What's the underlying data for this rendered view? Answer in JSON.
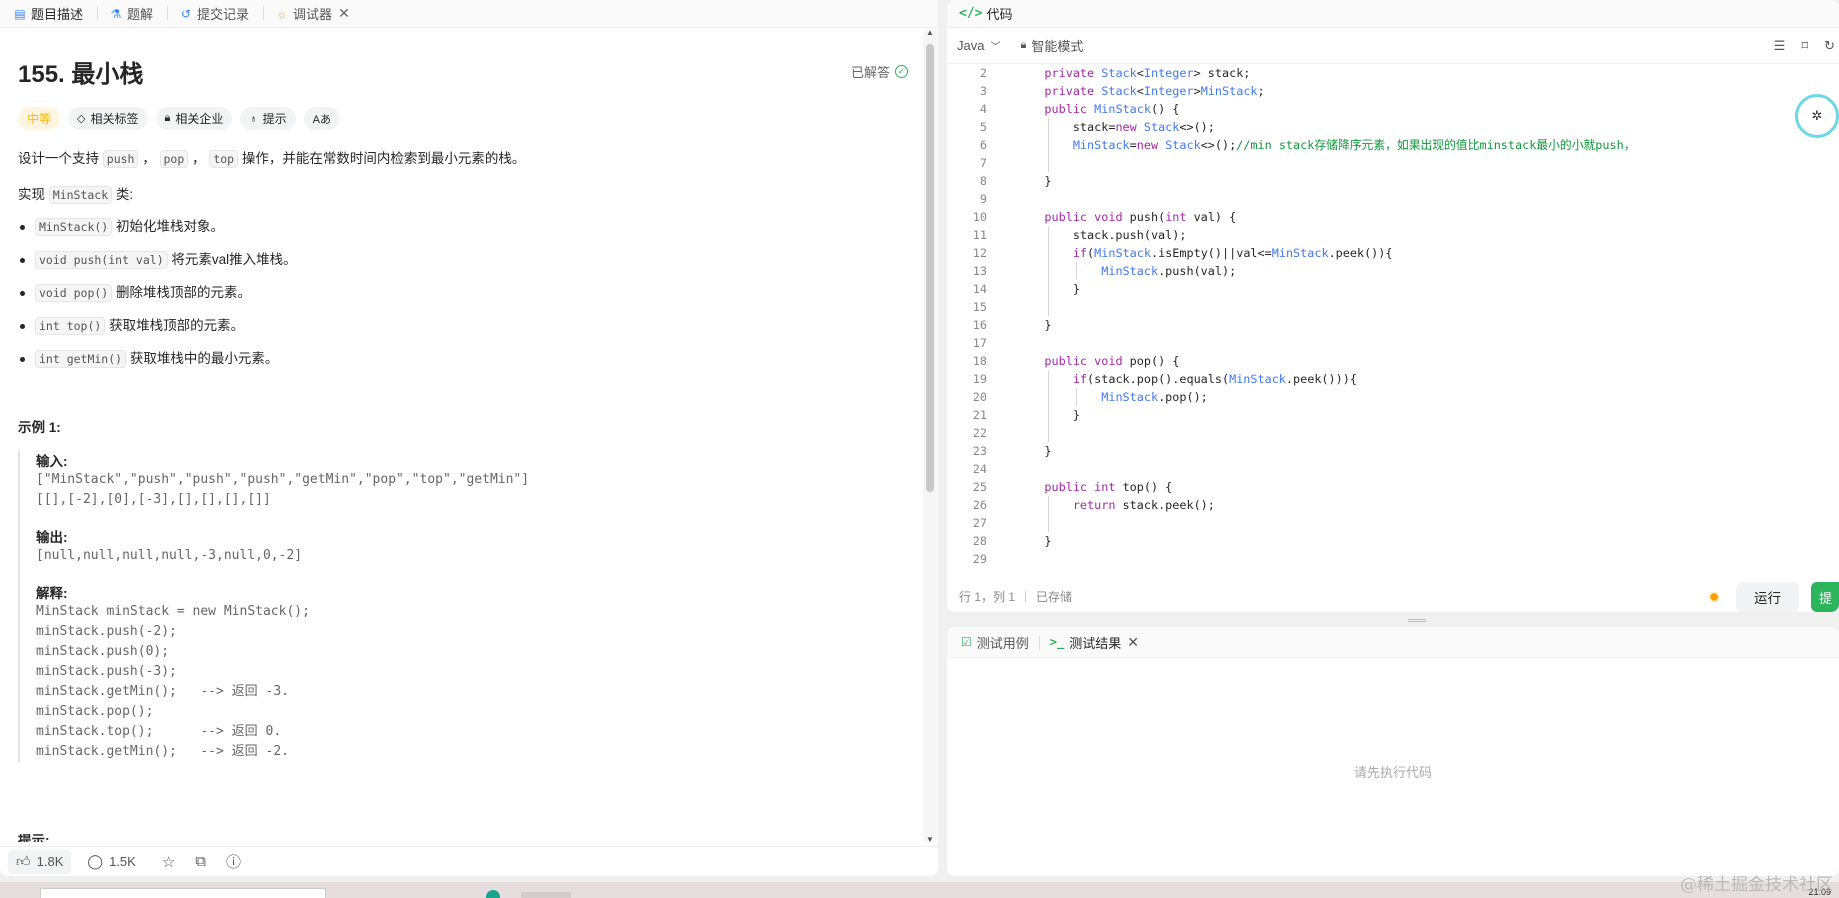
{
  "left_tabs": [
    {
      "label": "题目描述",
      "icon": "document-icon"
    },
    {
      "label": "题解",
      "icon": "flask-icon"
    },
    {
      "label": "提交记录",
      "icon": "history-icon"
    },
    {
      "label": "调试器",
      "icon": "debugger-icon",
      "close": "✕"
    }
  ],
  "problem": {
    "title": "155. 最小栈",
    "solved_label": "已解答",
    "tags": {
      "difficulty": "中等",
      "related_tags": "相关标签",
      "related_companies": "相关企业",
      "hint": "提示",
      "translate": "Aあ"
    },
    "desc_prefix": "设计一个支持",
    "desc_sep1": "，",
    "desc_sep2": "，",
    "desc_suffix": "操作，并能在常数时间内检索到最小元素的栈。",
    "desc_push": "push",
    "desc_pop": "pop",
    "desc_top": "top",
    "impl_prefix": "实现",
    "impl_class": "MinStack",
    "impl_suffix": "类:",
    "methods": [
      {
        "code": "MinStack()",
        "text": "初始化堆栈对象。"
      },
      {
        "code": "void push(int val)",
        "text": "将元素val推入堆栈。"
      },
      {
        "code": "void pop()",
        "text": "删除堆栈顶部的元素。"
      },
      {
        "code": "int top()",
        "text": "获取堆栈顶部的元素。"
      },
      {
        "code": "int getMin()",
        "text": "获取堆栈中的最小元素。"
      }
    ],
    "example_title": "示例 1:",
    "input_label": "输入:",
    "input_line1": "[\"MinStack\",\"push\",\"push\",\"push\",\"getMin\",\"pop\",\"top\",\"getMin\"]",
    "input_line2": "[[],[-2],[0],[-3],[],[],[],[]]",
    "output_label": "输出:",
    "output_line": "[null,null,null,null,-3,null,0,-2]",
    "explain_label": "解释:",
    "explain_lines": [
      "MinStack minStack = new MinStack();",
      "minStack.push(-2);",
      "minStack.push(0);",
      "minStack.push(-3);",
      "minStack.getMin();   --> 返回 -3.",
      "minStack.pop();",
      "minStack.top();      --> 返回 0.",
      "minStack.getMin();   --> 返回 -2."
    ],
    "hints_heading": "提示:"
  },
  "bottom_bar": {
    "likes": "1.8K",
    "comments": "1.5K"
  },
  "code_panel": {
    "title": "代码",
    "language": "Java",
    "mode": "智能模式",
    "status_position": "行 1，列 1",
    "status_saved": "已存储",
    "run_label": "运行",
    "submit_label": "提"
  },
  "code_lines": [
    "2",
    "3",
    "4",
    "5",
    "6",
    "7",
    "8",
    "9",
    "10",
    "11",
    "12",
    "13",
    "14",
    "15",
    "16",
    "17",
    "18",
    "19",
    "20",
    "21",
    "22",
    "23",
    "24",
    "25",
    "26",
    "27",
    "28",
    "29"
  ],
  "test_panel": {
    "tab_cases": "测试用例",
    "tab_result": "测试结果",
    "close": "✕",
    "placeholder": "请先执行代码"
  },
  "watermark": "@稀土掘金技术社区",
  "clock": "21:09",
  "colors": {
    "accent_green": "#2db55d",
    "difficulty_orange": "#ffb800",
    "keyword": "#a626a4",
    "type": "#4078f2",
    "comment": "#10993b"
  }
}
